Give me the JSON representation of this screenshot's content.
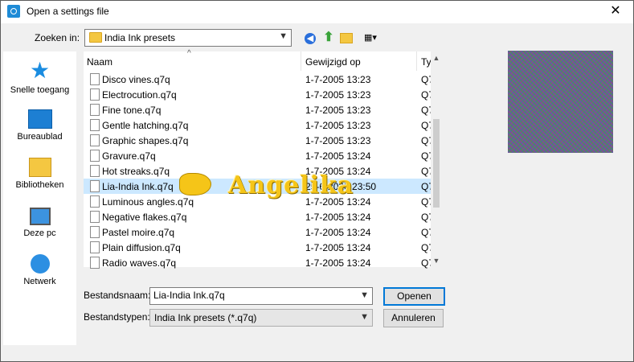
{
  "window": {
    "title": "Open a settings file",
    "close_glyph": "✕"
  },
  "toolbar": {
    "lookin_label": "Zoeken in:",
    "lookin_value": "India Ink presets",
    "icons": [
      "back-arrow-icon",
      "up-folder-icon",
      "new-folder-icon",
      "view-menu-icon"
    ]
  },
  "nav": [
    {
      "label": "Snelle toegang",
      "icon": "quick-access-star-icon"
    },
    {
      "label": "Bureaublad",
      "icon": "desktop-icon"
    },
    {
      "label": "Bibliotheken",
      "icon": "libraries-icon"
    },
    {
      "label": "Deze pc",
      "icon": "this-pc-icon"
    },
    {
      "label": "Netwerk",
      "icon": "network-icon"
    }
  ],
  "columns": {
    "name": "Naam",
    "modified": "Gewijzigd op",
    "type": "Ty"
  },
  "files": [
    {
      "name": "Disco vines.q7q",
      "date": "1-7-2005 13:23",
      "type": "Q7"
    },
    {
      "name": "Electrocution.q7q",
      "date": "1-7-2005 13:23",
      "type": "Q7"
    },
    {
      "name": "Fine tone.q7q",
      "date": "1-7-2005 13:23",
      "type": "Q7"
    },
    {
      "name": "Gentle hatching.q7q",
      "date": "1-7-2005 13:23",
      "type": "Q7"
    },
    {
      "name": "Graphic shapes.q7q",
      "date": "1-7-2005 13:23",
      "type": "Q7"
    },
    {
      "name": "Gravure.q7q",
      "date": "1-7-2005 13:24",
      "type": "Q7"
    },
    {
      "name": "Hot streaks.q7q",
      "date": "1-7-2005 13:24",
      "type": "Q7"
    },
    {
      "name": "Lia-India Ink.q7q",
      "date": "25-6-2020 23:50",
      "type": "Q7"
    },
    {
      "name": "Luminous angles.q7q",
      "date": "1-7-2005 13:24",
      "type": "Q7"
    },
    {
      "name": "Negative flakes.q7q",
      "date": "1-7-2005 13:24",
      "type": "Q7"
    },
    {
      "name": "Pastel moire.q7q",
      "date": "1-7-2005 13:24",
      "type": "Q7"
    },
    {
      "name": "Plain diffusion.q7q",
      "date": "1-7-2005 13:24",
      "type": "Q7"
    },
    {
      "name": "Radio waves.q7q",
      "date": "1-7-2005 13:24",
      "type": "Q7"
    }
  ],
  "selected_index": 7,
  "bottom": {
    "filename_label": "Bestandsnaam:",
    "filename_value": "Lia-India Ink.q7q",
    "filetype_label": "Bestandstypen:",
    "filetype_value": "India Ink presets (*.q7q)",
    "open_label": "Openen",
    "cancel_label": "Annuleren"
  },
  "watermark": {
    "text": "Angelika"
  }
}
